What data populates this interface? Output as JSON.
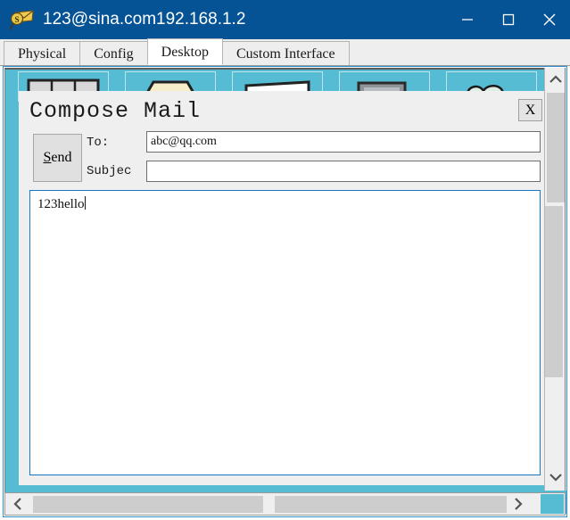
{
  "window": {
    "title": "123@sina.com192.168.1.2",
    "icon": "mail-magnifier-icon",
    "titlebar_color": "#055395",
    "controls": {
      "minimize": "minimize-icon",
      "maximize": "maximize-icon",
      "close": "close-icon"
    }
  },
  "tabs": [
    {
      "label": "Physical",
      "active": false
    },
    {
      "label": "Config",
      "active": false
    },
    {
      "label": "Desktop",
      "active": true
    },
    {
      "label": "Custom Interface",
      "active": false
    }
  ],
  "desktop": {
    "background_color": "#55bcd4",
    "icons": [
      {
        "name": "window-icon"
      },
      {
        "name": "folder-icon"
      },
      {
        "name": "document-icon"
      },
      {
        "name": "monitor-icon"
      },
      {
        "name": "cloud-icon"
      }
    ]
  },
  "compose": {
    "title": "Compose Mail",
    "close_label": "X",
    "send_label": "Send",
    "send_accelerator": "S",
    "to_label": "To:",
    "subject_label": "Subjec",
    "to_value": "abc@qq.com",
    "to_placeholder": "",
    "subject_value": "",
    "subject_placeholder": "",
    "body_value": "123hello",
    "body_placeholder": "",
    "border_color": "#1878c8"
  },
  "scrollbars": {
    "vertical": {
      "up_icon": "chevron-up-icon",
      "down_icon": "chevron-down-icon"
    },
    "horizontal": {
      "left_icon": "chevron-left-icon",
      "right_icon": "chevron-right-icon"
    }
  }
}
